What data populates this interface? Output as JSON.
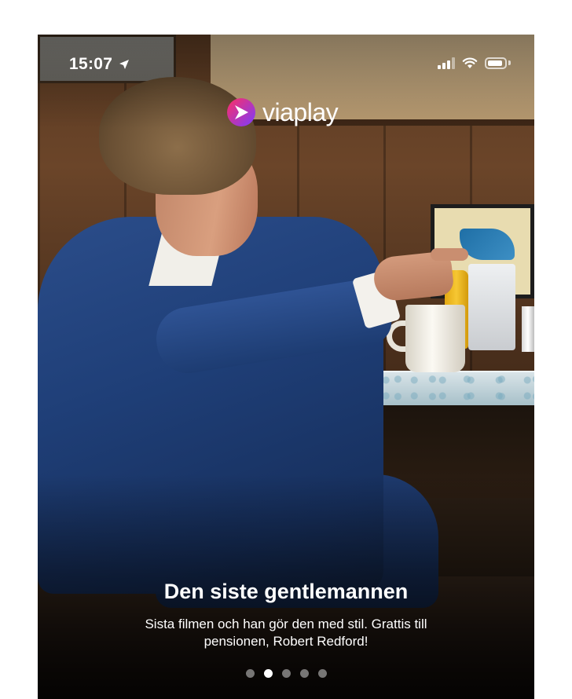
{
  "status_bar": {
    "time": "15:07",
    "location_icon": "location-arrow-icon",
    "signal_icon": "cellular-signal-icon",
    "wifi_icon": "wifi-icon",
    "battery_icon": "battery-icon"
  },
  "brand": {
    "logo_text": "viaplay",
    "logo_colors": [
      "#ff2e63",
      "#7a3cff"
    ]
  },
  "hero": {
    "title": "Den siste gentlemannen",
    "subtitle": "Sista filmen och han gör den med stil. Grattis till pensionen, Robert Redford!",
    "image_description": "hero-image"
  },
  "carousel": {
    "total": 5,
    "active_index": 1
  }
}
